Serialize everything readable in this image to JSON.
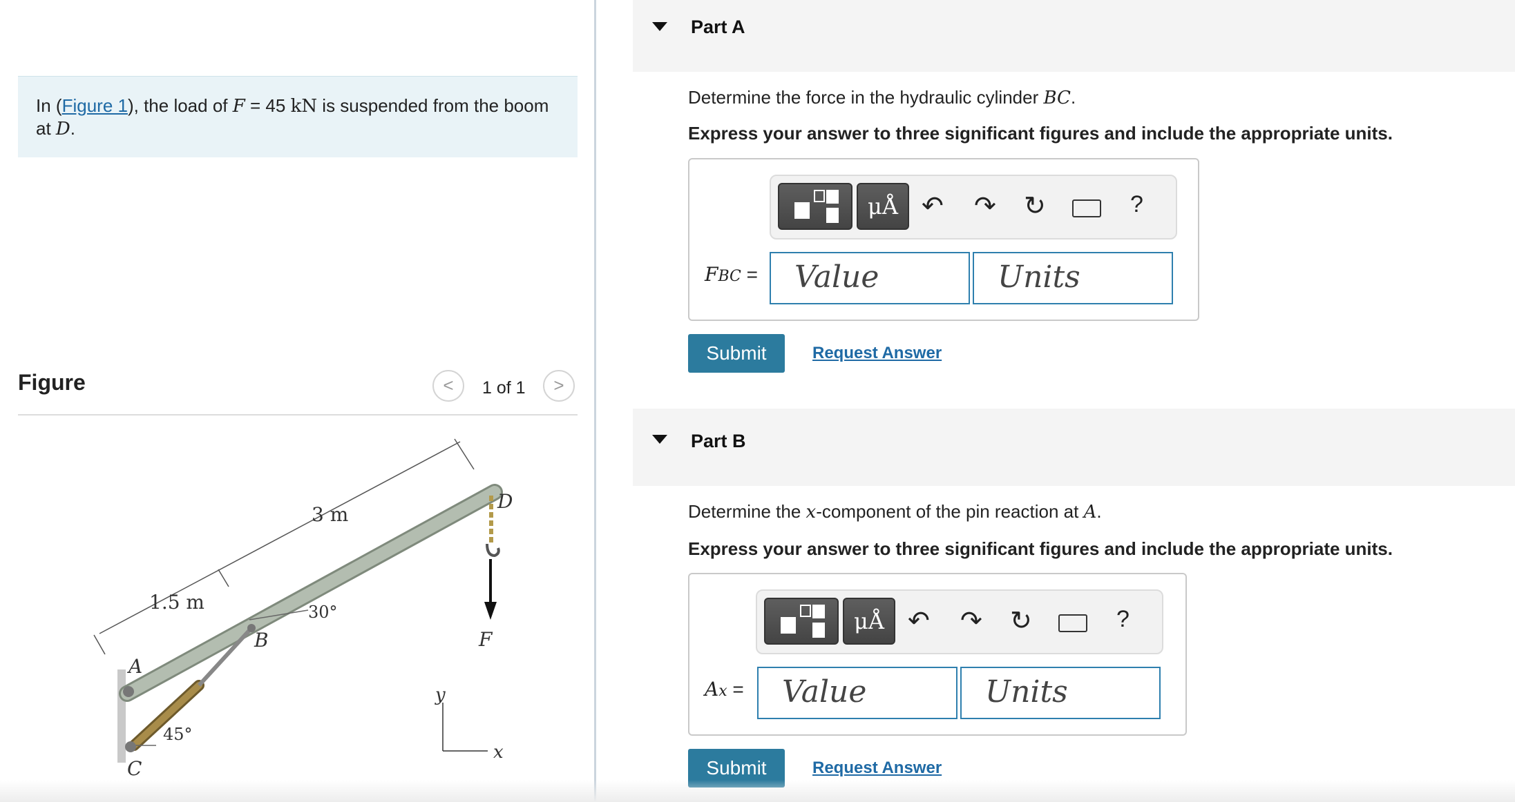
{
  "problem": {
    "prefix": "In (",
    "figure_link": "Figure 1",
    "after_link": "), the load of ",
    "force_symbol": "F",
    "equals_value": " = 45 ",
    "unit": "kN",
    "suffix": " is suspended from the boom at ",
    "point": "D",
    "end": "."
  },
  "figure": {
    "heading": "Figure",
    "prev_glyph": "<",
    "next_glyph": ">",
    "count": "1 of 1",
    "labels": {
      "dim_3m": "3 m",
      "dim_1_5m": "1.5 m",
      "angle_30": "30°",
      "angle_45": "45°",
      "A": "A",
      "B": "B",
      "C": "C",
      "D": "D",
      "F": "F",
      "x": "x",
      "y": "y"
    }
  },
  "parts": [
    {
      "title": "Part A",
      "question_prefix": "Determine the force in the hydraulic cylinder ",
      "question_symbol": "BC",
      "question_suffix": ".",
      "instruction": "Express your answer to three significant figures and include the appropriate units.",
      "var_main": "F",
      "var_sub": "BC",
      "equals": " =",
      "value_placeholder": "Value",
      "units_placeholder": "Units",
      "submit_label": "Submit",
      "request_label": "Request Answer"
    },
    {
      "title": "Part B",
      "question_prefix": "Determine the ",
      "question_symbol": "x",
      "question_suffix": "-component of the pin reaction at ",
      "question_point": "A",
      "question_end": ".",
      "instruction": "Express your answer to three significant figures and include the appropriate units.",
      "var_main": "A",
      "var_sub": "x",
      "equals": " =",
      "value_placeholder": "Value",
      "units_placeholder": "Units",
      "submit_label": "Submit",
      "request_label": "Request Answer"
    }
  ],
  "toolbar": {
    "units_button": "μÅ",
    "help": "?",
    "icons": [
      "templates-icon",
      "units-icon",
      "undo-icon",
      "redo-icon",
      "reset-icon",
      "keyboard-icon",
      "help-icon"
    ]
  },
  "colors": {
    "link": "#1f6aa5",
    "submit_bg": "#2c7b9e",
    "input_border": "#2e7fae",
    "problem_bg": "#e9f3f7",
    "boom": "#a9b4a6"
  }
}
